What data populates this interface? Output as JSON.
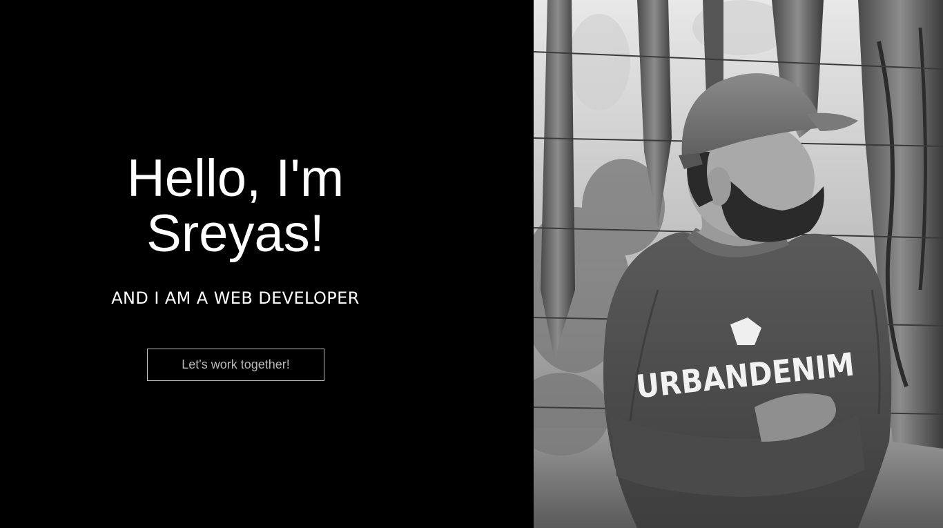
{
  "hero": {
    "greeting_line1": "Hello, I'm",
    "greeting_line2": "Sreyas!",
    "subtitle": "AND I AM A WEB DEVELOPER",
    "cta_label": "Let's work together!"
  },
  "photo": {
    "shirt_text": "URBANDENIM",
    "icon": "portrait-photo-icon"
  },
  "colors": {
    "background": "#000000",
    "text": "#ffffff",
    "button_border": "#bdbdbd",
    "button_text": "#b9b9b9"
  }
}
